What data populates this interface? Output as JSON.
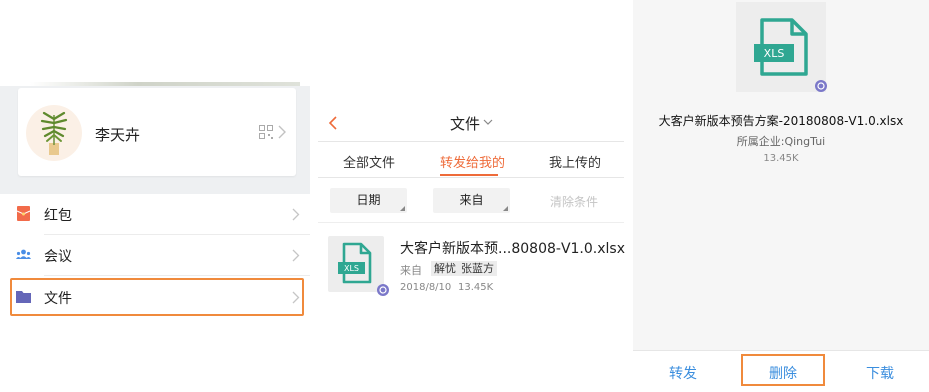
{
  "panel1": {
    "profile": {
      "name": "李天卉"
    },
    "menu": [
      {
        "label": "红包",
        "icon": "red-envelope-icon"
      },
      {
        "label": "会议",
        "icon": "meeting-people-icon"
      },
      {
        "label": "文件",
        "icon": "folder-icon"
      }
    ]
  },
  "panel2": {
    "title": "文件",
    "tabs": [
      {
        "label": "全部文件",
        "active": false
      },
      {
        "label": "转发给我的",
        "active": true
      },
      {
        "label": "我上传的",
        "active": false
      }
    ],
    "filters": {
      "date": "日期",
      "from": "来自",
      "clear": "清除条件"
    },
    "file": {
      "name": "大客户新版本预...80808-V1.0.xlsx",
      "from_label": "来自",
      "tags": [
        "解忧",
        "张蓝方"
      ],
      "date": "2018/8/10",
      "size": "13.45K",
      "type_label": "XLS"
    }
  },
  "panel3": {
    "type_label": "XLS",
    "filename": "大客户新版本预告方案-20180808-V1.0.xlsx",
    "company": "所属企业:QingTui",
    "size": "13.45K",
    "actions": {
      "forward": "转发",
      "delete": "删除",
      "download": "下载"
    }
  },
  "colors": {
    "accent_orange": "#ee6b3a",
    "highlight_box": "#f08a3c",
    "file_teal": "#2fa792",
    "link_blue": "#3b8ede",
    "badge_purple": "#7b78c9"
  }
}
